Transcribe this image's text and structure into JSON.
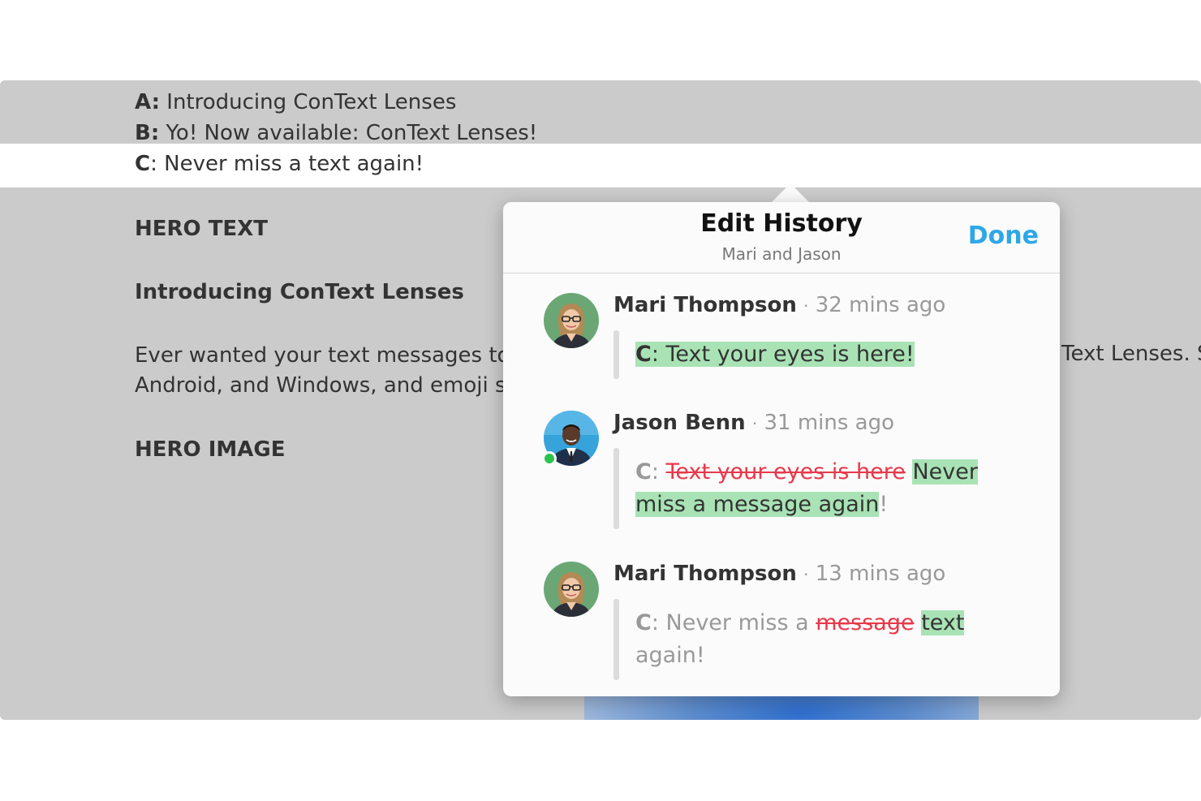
{
  "document": {
    "options": [
      {
        "letter": "A:",
        "text": " Introducing ConText Lenses"
      },
      {
        "letter": "B:",
        "text": " Yo! Now available: ConText Lenses!"
      },
      {
        "letter": "C",
        "text": ": Never miss a text again!"
      }
    ],
    "hero_text_heading": "HERO TEXT",
    "hero_text_value": "Introducing ConText Lenses",
    "body_line_1": "Ever wanted your text messages to c",
    "body_line_2": "Android, and Windows, and emoji s",
    "body_right_fragment": "Text Lenses. S",
    "hero_image_heading": "HERO IMAGE"
  },
  "popover": {
    "title": "Edit History",
    "subtitle": "Mari and Jason",
    "done_label": "Done",
    "sep": "·",
    "entries": [
      {
        "author": "Mari Thompson",
        "time": "32 mins ago",
        "letter": "C",
        "colon": ": ",
        "added": "Text your eyes is here!"
      },
      {
        "author": "Jason Benn",
        "time": "31 mins ago",
        "online": true,
        "letter": "C",
        "colon": ": ",
        "deleted": "Text your eyes is here",
        "added_1": "Never",
        "added_2": "miss a message again",
        "tail": "!"
      },
      {
        "author": "Mari Thompson",
        "time": "13 mins ago",
        "letter": "C",
        "text_before": ": Never miss a ",
        "deleted": "message",
        "added": "text",
        "text_after": "again!"
      }
    ]
  },
  "colors": {
    "accent": "#2ea7e7",
    "added_bg": "#a9e3b5",
    "deleted": "#e8394a",
    "online": "#2dc24d"
  }
}
